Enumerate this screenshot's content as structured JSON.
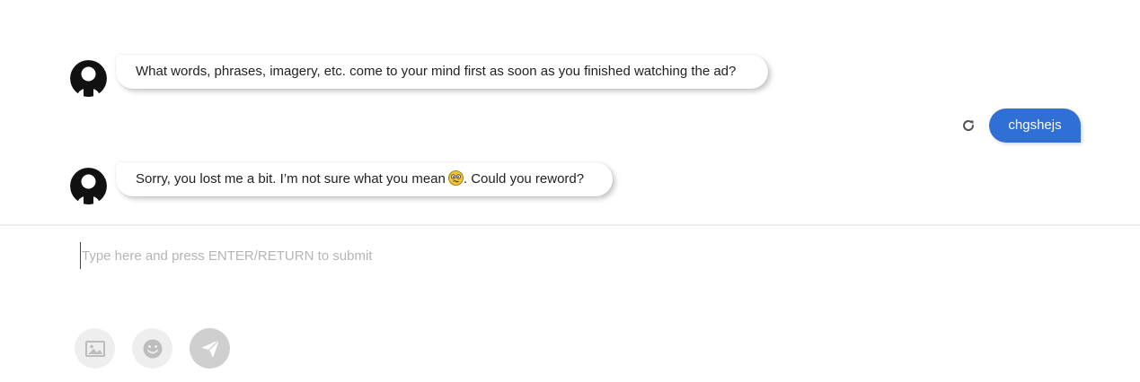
{
  "messages": [
    {
      "sender": "bot",
      "text": "What words, phrases, imagery, etc. come to your mind first as soon as you finished watching the ad?"
    },
    {
      "sender": "user",
      "text": "chgshejs"
    },
    {
      "sender": "bot",
      "text_before_emoji": "Sorry, you lost me a bit. I’m not sure what you mean",
      "emoji": "confused-face-emoji",
      "text_after_emoji": ". Could you reword?"
    }
  ],
  "composer": {
    "placeholder": "Type here and press ENTER/RETURN to submit",
    "value": ""
  },
  "icons": {
    "avatar": "person-icon",
    "retry": "retry-icon",
    "image_upload": "image-icon",
    "emoji_picker": "smiley-icon",
    "send": "send-icon"
  },
  "colors": {
    "user_bubble": "#2f6fd6",
    "avatar": "#111111",
    "placeholder": "#b5b5b5",
    "tool_button_bg": "#eeeeee",
    "send_button_bg": "#cfcfcf"
  }
}
